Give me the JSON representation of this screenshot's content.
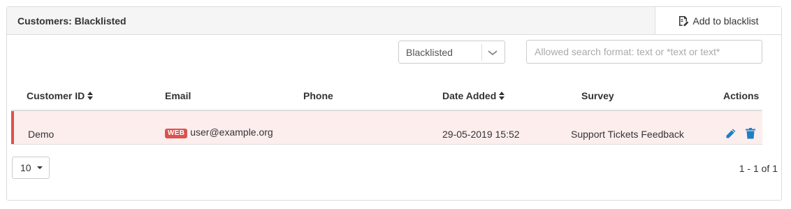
{
  "panel": {
    "title": "Customers: Blacklisted",
    "add_button_label": "Add to blacklist"
  },
  "filters": {
    "status_selected": "Blacklisted",
    "search_placeholder": "Allowed search format: text or *text or text*",
    "search_value": ""
  },
  "table": {
    "columns": [
      "Customer ID",
      "Email",
      "Phone",
      "Date Added",
      "Survey",
      "Actions"
    ],
    "rows": [
      {
        "customer_id": "Demo",
        "email_badge": "WEB",
        "email": "user@example.org",
        "phone": "",
        "date_added": "29-05-2019 15:52",
        "survey": "Support Tickets Feedback"
      }
    ]
  },
  "pagination": {
    "page_size": "10",
    "range_text": "1 - 1 of 1"
  },
  "colors": {
    "row_highlight": "#fdeeee",
    "row_accent": "#d9534f",
    "action_icon": "#1f7fc2"
  }
}
